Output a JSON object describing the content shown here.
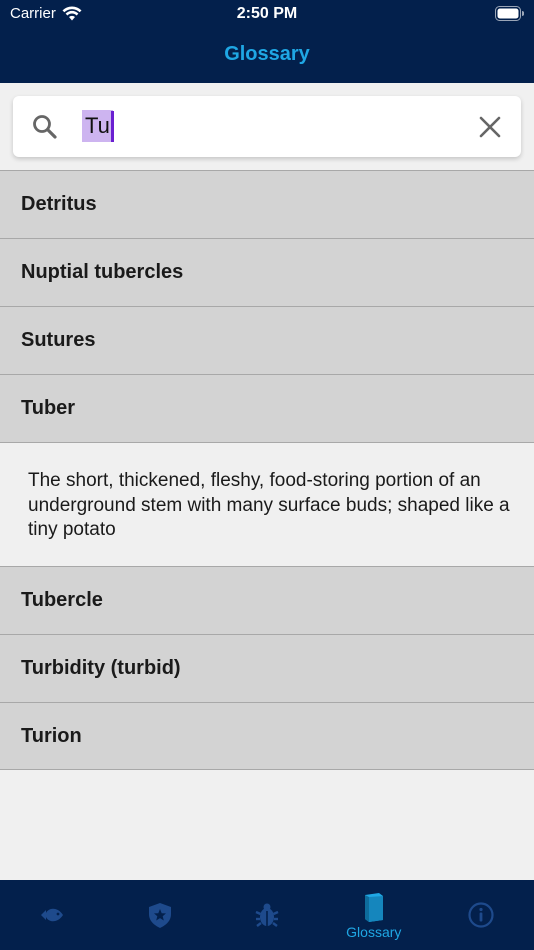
{
  "status_bar": {
    "carrier": "Carrier",
    "time": "2:50 PM"
  },
  "nav": {
    "title": "Glossary"
  },
  "search": {
    "value": "Tu",
    "placeholder": ""
  },
  "terms": [
    {
      "label": "Detritus"
    },
    {
      "label": "Nuptial tubercles"
    },
    {
      "label": "Sutures"
    },
    {
      "label": "Tuber",
      "expanded": true,
      "definition": "The short, thickened, fleshy, food-storing portion of an underground stem with many surface buds; shaped like a tiny potato"
    },
    {
      "label": "Tubercle"
    },
    {
      "label": "Turbidity (turbid)"
    },
    {
      "label": "Turion"
    }
  ],
  "tabs": [
    {
      "icon": "fish-icon"
    },
    {
      "icon": "shield-star-icon"
    },
    {
      "icon": "bug-icon"
    },
    {
      "icon": "book-icon",
      "label": "Glossary",
      "active": true
    },
    {
      "icon": "info-icon"
    }
  ],
  "colors": {
    "bar_bg": "#03204c",
    "accent": "#1fa7e4",
    "row_bg": "#d3d3d3",
    "inactive_icon": "#1e4a8c"
  }
}
